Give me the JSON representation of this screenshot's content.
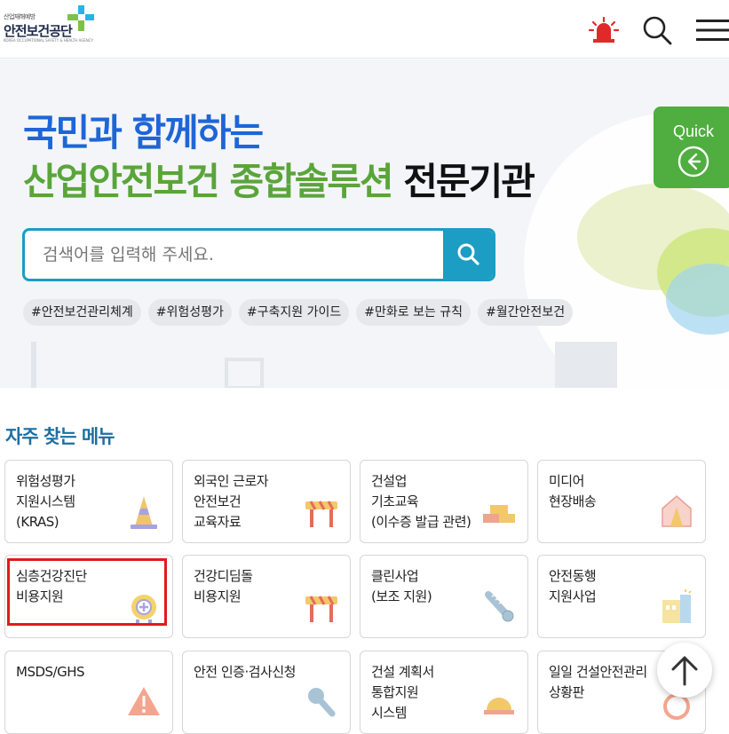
{
  "header": {
    "logo_subtitle": "산업재해예방",
    "logo_name": "안전보건공단",
    "logo_english": "KOREA OCCUPATIONAL SAFETY & HEALTH AGENCY",
    "icons": [
      "siren-icon",
      "search-icon",
      "menu-icon"
    ]
  },
  "hero": {
    "headline_line1": "국민과 함께하는",
    "headline_line2_green": "산업안전보건 종합솔루션",
    "headline_line2_black": "전문기관",
    "search_placeholder": "검색어를 입력해 주세요.",
    "tags": [
      "#안전보건관리체계",
      "#위험성평가",
      "#구축지원 가이드",
      "#만화로 보는 규칙",
      "#월간안전보건"
    ],
    "quick_label": "Quick"
  },
  "menu": {
    "title": "자주 찾는 메뉴",
    "items": [
      {
        "label": "위험성평가\n지원시스템\n(KRAS)",
        "icon": "traffic-cone-icon"
      },
      {
        "label": "외국인 근로자\n안전보건\n교육자료",
        "icon": "barrier-icon"
      },
      {
        "label": "건설업\n기초교육\n(이수증 발급 관련)",
        "icon": "bricks-icon"
      },
      {
        "label": "미디어\n현장배송",
        "icon": "house-cone-icon"
      },
      {
        "label": "심층건강진단\n비용지원",
        "icon": "medical-badge-icon"
      },
      {
        "label": "건강디딤돌\n비용지원",
        "icon": "barrier-icon"
      },
      {
        "label": "클린사업\n(보조 지원)",
        "icon": "screw-icon"
      },
      {
        "label": "안전동행\n지원사업",
        "icon": "building-icon"
      },
      {
        "label": "MSDS/GHS",
        "icon": "warning-icon"
      },
      {
        "label": "안전 인증·검사신청",
        "icon": "wrench-icon"
      },
      {
        "label": "건설 계획서\n통합지원\n시스템",
        "icon": "helmet-icon"
      },
      {
        "label": "일일 건설안전관리\n상황판",
        "icon": "no-entry-icon"
      }
    ]
  },
  "colors": {
    "brand_blue": "#1e66d6",
    "brand_green": "#5aa53a",
    "search_teal": "#1b9dc4",
    "quick_green": "#4fae3f",
    "section_title": "#1b6fa3",
    "highlight_red": "#e01b1b"
  }
}
